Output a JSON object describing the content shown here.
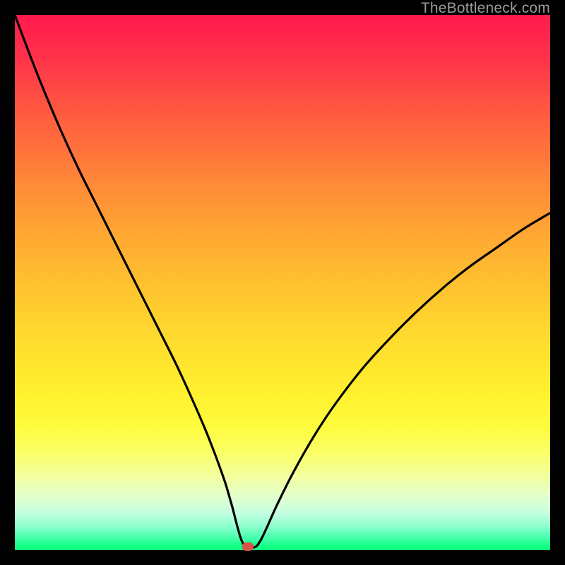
{
  "watermark": "TheBottleneck.com",
  "marker": {
    "x_pct": 43.5,
    "y_pct": 99.3,
    "color": "#d9534a"
  },
  "chart_data": {
    "type": "line",
    "title": "",
    "xlabel": "",
    "ylabel": "",
    "xlim": [
      0,
      100
    ],
    "ylim": [
      0,
      100
    ],
    "grid": false,
    "legend": false,
    "series": [
      {
        "name": "bottleneck-curve",
        "x": [
          0.0,
          3.0,
          6.0,
          9.0,
          12.0,
          15.0,
          18.0,
          21.0,
          24.0,
          27.0,
          30.0,
          33.0,
          36.0,
          39.0,
          40.5,
          42.5,
          44.5,
          46.0,
          49.0,
          52.0,
          56.0,
          60.0,
          65.0,
          70.0,
          75.0,
          80.0,
          85.0,
          90.0,
          95.0,
          100.0
        ],
        "y": [
          100.0,
          92.0,
          84.5,
          77.5,
          71.0,
          65.0,
          59.0,
          53.0,
          47.0,
          41.0,
          35.0,
          28.5,
          21.5,
          13.5,
          8.5,
          1.5,
          0.5,
          2.0,
          8.5,
          14.5,
          21.5,
          27.5,
          34.0,
          39.5,
          44.5,
          49.0,
          53.0,
          56.5,
          60.0,
          63.0
        ]
      }
    ],
    "annotations": [
      {
        "type": "marker",
        "x": 43.5,
        "y": 0.7,
        "label": ""
      }
    ],
    "background_gradient": {
      "top_color": "#ff1a4d",
      "mid_color": "#ffd02e",
      "bottom_color": "#0cff79"
    }
  }
}
